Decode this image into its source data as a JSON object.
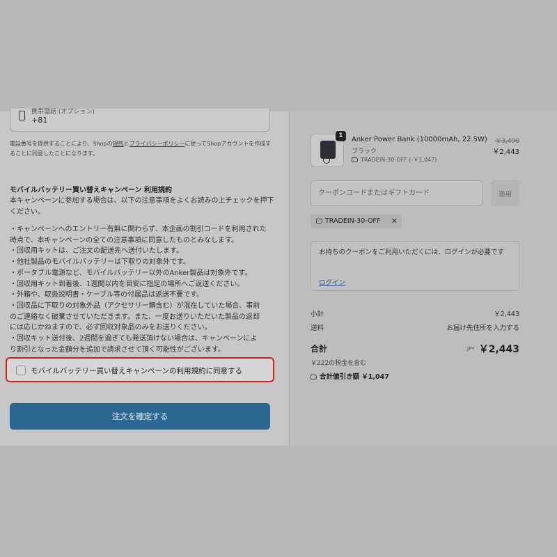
{
  "form": {
    "phone_label": "携帯電話 (オプション)",
    "phone_value": "+81",
    "notice_pre": "電話番号を提供することにより、Shopの",
    "notice_link1": "規約",
    "notice_mid": "と",
    "notice_link2": "プライバシーポリシー",
    "notice_post": "に従ってShopアカウントを作成することに同意したことになります。"
  },
  "campaign": {
    "title": "モバイルバッテリー買い替えキャンペーン 利用規約",
    "intro": "本キャンペーンに参加する場合は、以下の注意事項をよくお読みの上チェックを押下ください。",
    "terms_lines": [
      "・キャンペーンへのエントリー有無に関わらず、本企画の割引コードを利用された",
      "時点で、本キャンペーンの全ての注意事項に同意したものとみなします。",
      "・回収用キットは、ご注文の配送先へ送付いたします。",
      "・他社製品のモバイルバッテリーは下取りの対象外です。",
      "・ポータブル電源など、モバイルバッテリー以外のAnker製品は対象外です。",
      "・回収用キット到着後、1週間以内を目安に指定の場所へご返送ください。",
      "・外箱や、取扱説明書・ケーブル等の付属品は返送不要です。",
      "・回収品に下取りの対象外品（アクセサリー類含む）が混在していた場合、事前",
      "のご連絡なく破棄させていただきます。また、一度お送りいただいた製品の返却",
      "には応じかねますので、必ず回収対象品のみをお送りください。",
      "・回収キット送付後、2週間を過ぎても発送頂けない場合は、キャンペーンによ",
      "り割引となった金額分を追加で請求させて頂く可能性がございます。"
    ],
    "agree_label": "モバイルバッテリー買い替えキャンペーンの利用規約に同意する"
  },
  "confirm_label": "注文を確定する",
  "order": {
    "badge": "1",
    "product_name": "Anker Power Bank (10000mAh, 22.5W)",
    "product_color": "ブラック",
    "product_discount": "TRADEIN-30-OFF (-￥1,047)",
    "price_old": "￥3,490",
    "price_new": "￥2,443",
    "coupon_placeholder": "クーポンコードまたはギフトカード",
    "apply_label": "適用",
    "applied_code": "TRADEIN-30-OFF",
    "login_msg": "お持ちのクーポンをご利用いただくには、ログインが必要です",
    "login_link": "ログイン",
    "subtotal_label": "小計",
    "subtotal_value": "￥2,443",
    "shipping_label": "送料",
    "shipping_value": "お届け先住所を入力する",
    "total_label": "合計",
    "total_currency": "JPY",
    "total_value": "￥2,443",
    "tax_note": "￥222の税金を含む",
    "savings": "合計値引き額 ￥1,047"
  }
}
